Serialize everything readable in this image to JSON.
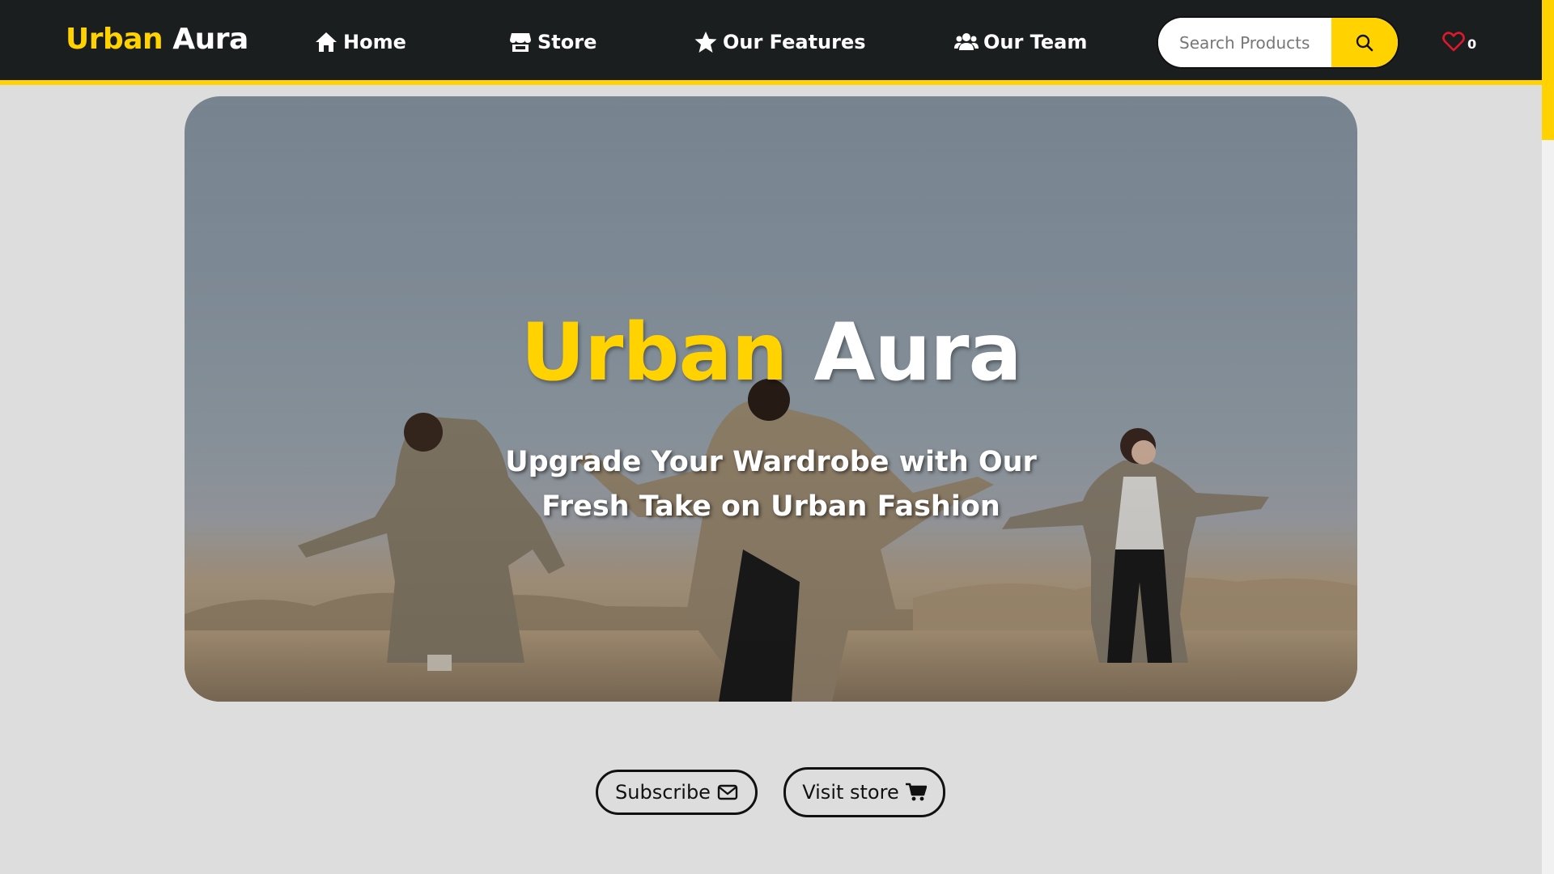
{
  "brand": {
    "part1": "Urban",
    "part2": "Aura"
  },
  "nav": {
    "home": "Home",
    "store": "Store",
    "features": "Our Features",
    "team": "Our Team"
  },
  "search": {
    "placeholder": "Search Products",
    "value": ""
  },
  "wishlist": {
    "count": "0"
  },
  "hero": {
    "title_part1": "Urban",
    "title_part2": "Aura",
    "subtitle_line1": "Upgrade Your Wardrobe with Our",
    "subtitle_line2": "Fresh Take on Urban Fashion"
  },
  "actions": {
    "subscribe": "Subscribe",
    "visit_store": "Visit store"
  },
  "icons": {
    "home": "home-icon",
    "store": "store-icon",
    "features": "star-icon",
    "team": "users-icon",
    "search": "search-icon",
    "wishlist": "heart-icon",
    "subscribe": "envelope-icon",
    "visit_store": "cart-icon"
  },
  "colors": {
    "accent": "#ffd200",
    "navbar_bg": "#1b1e1e",
    "page_bg": "#dddddd",
    "heart": "#e0182d"
  }
}
